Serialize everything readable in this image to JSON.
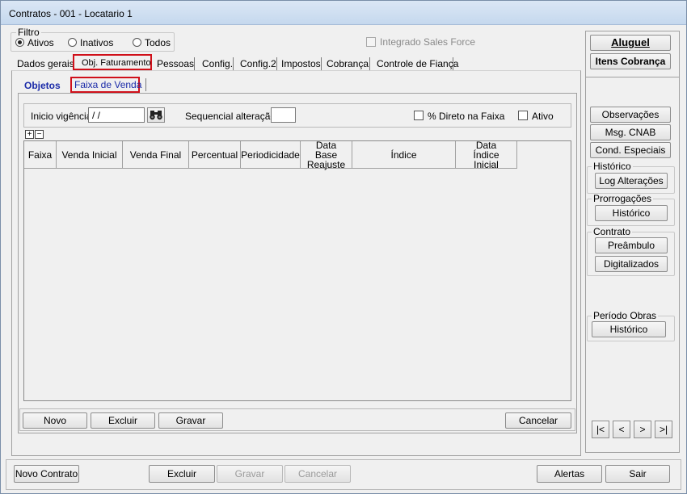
{
  "window": {
    "title": "Contratos - 001 - Locatario 1"
  },
  "filter": {
    "caption": "Filtro",
    "options": [
      "Ativos",
      "Inativos",
      "Todos"
    ],
    "selected": "Ativos",
    "integrado_label": "Integrado Sales Force"
  },
  "tabs": [
    "Dados gerais",
    "Obj. Faturamento",
    "Pessoas",
    "Config.",
    "Config.2",
    "Impostos",
    "Cobrança",
    "Controle de Fiança"
  ],
  "active_tab": "Obj. Faturamento",
  "subtabs": [
    "Objetos",
    "Faixa de Venda"
  ],
  "active_subtab": "Faixa de Venda",
  "form": {
    "inicio_label": "Inicio vigência",
    "inicio_value": " / /",
    "sequencial_label": "Sequencial alteração",
    "sequencial_value": "",
    "direto_label": "% Direto na Faixa",
    "ativo_label": "Ativo"
  },
  "expand": {
    "plus": "+",
    "minus": "−"
  },
  "grid": {
    "columns": [
      "Faixa",
      "Venda Inicial",
      "Venda Final",
      "Percentual",
      "Periodicidade",
      "Data Base Reajuste",
      "Índice",
      "Data Índice Inicial"
    ]
  },
  "inner_buttons": {
    "novo": "Novo",
    "excluir": "Excluir",
    "gravar": "Gravar",
    "cancelar": "Cancelar"
  },
  "side": {
    "aluguel": "Aluguel",
    "itens_cobranca": "Itens Cobrança",
    "observacoes": "Observações",
    "msg_cnab": "Msg. CNAB",
    "cond_especiais": "Cond. Especiais",
    "historico_caption": "Histórico",
    "log_alteracoes": "Log Alterações",
    "prorrogacoes_caption": "Prorrogações",
    "prorrogacoes_btn": "Histórico",
    "contrato_caption": "Contrato",
    "preambulo": "Preâmbulo",
    "digitalizados": "Digitalizados",
    "periodo_caption": "Período Obras",
    "periodo_btn": "Histórico"
  },
  "nav": {
    "first": "|<",
    "prev": "<",
    "next": ">",
    "last": ">|"
  },
  "bottom": {
    "novo_contrato": "Novo Contrato",
    "excluir": "Excluir",
    "gravar": "Gravar",
    "cancelar": "Cancelar",
    "alertas": "Alertas",
    "sair": "Sair"
  }
}
